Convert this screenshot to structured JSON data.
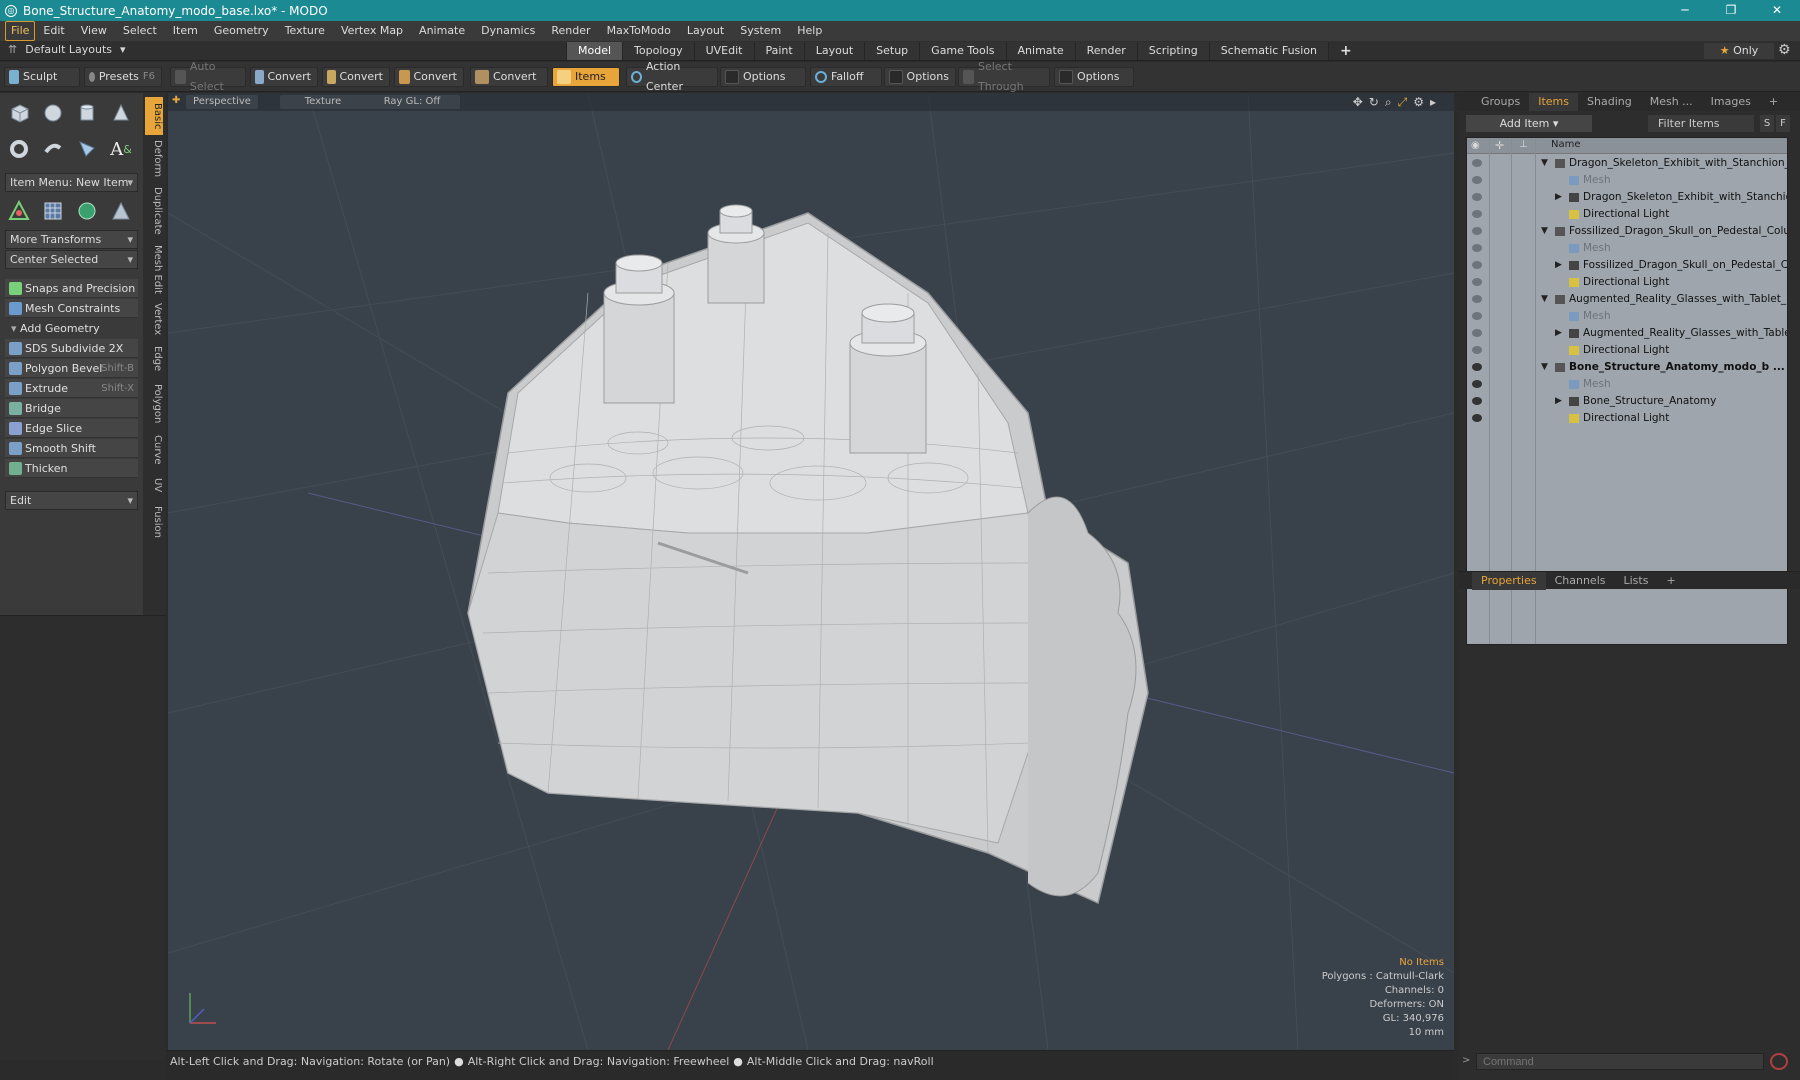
{
  "window": {
    "title": "Bone_Structure_Anatomy_modo_base.lxo* - MODO",
    "controls": [
      "─",
      "❐",
      "✕"
    ]
  },
  "menu": [
    "File",
    "Edit",
    "View",
    "Select",
    "Item",
    "Geometry",
    "Texture",
    "Vertex Map",
    "Animate",
    "Dynamics",
    "Render",
    "MaxToModo",
    "Layout",
    "System",
    "Help"
  ],
  "layoutbar": {
    "default_layouts": "Default Layouts",
    "tabs": [
      "Model",
      "Topology",
      "UVEdit",
      "Paint",
      "Layout",
      "Setup",
      "Game Tools",
      "Animate",
      "Render",
      "Scripting",
      "Schematic Fusion"
    ],
    "active_tab": "Model",
    "only": "Only"
  },
  "toolbar": {
    "sculpt": "Sculpt",
    "presets": "Presets",
    "presets_key": "F6",
    "auto_select": "Auto Select",
    "convert": "Convert",
    "items": "Items",
    "action_center": "Action Center",
    "options": "Options",
    "falloff": "Falloff",
    "select_through": "Select Through"
  },
  "left": {
    "item_menu": "Item Menu: New Item",
    "more_transforms": "More Transforms",
    "center_selected": "Center Selected",
    "snaps": "Snaps and Precision",
    "mesh_constraints": "Mesh Constraints",
    "add_geometry": "Add Geometry",
    "tools": [
      {
        "label": "SDS Subdivide 2X",
        "shortcut": ""
      },
      {
        "label": "Polygon Bevel",
        "shortcut": "Shift-B"
      },
      {
        "label": "Extrude",
        "shortcut": "Shift-X"
      },
      {
        "label": "Bridge",
        "shortcut": ""
      },
      {
        "label": "Edge Slice",
        "shortcut": ""
      },
      {
        "label": "Smooth Shift",
        "shortcut": ""
      },
      {
        "label": "Thicken",
        "shortcut": ""
      }
    ],
    "edit": "Edit",
    "vtabs": [
      "Basic",
      "Deform",
      "Duplicate",
      "Mesh Edit",
      "Vertex",
      "Edge",
      "Polygon",
      "Curve",
      "UV",
      "Fusion"
    ]
  },
  "viewport": {
    "perspective": "Perspective",
    "texture": "Texture",
    "raygl": "Ray GL: Off",
    "stats": {
      "no_items": "No Items",
      "polygons": "Polygons : Catmull-Clark",
      "channels": "Channels: 0",
      "deformers": "Deformers: ON",
      "gl": "GL: 340,976",
      "scale": "10 mm"
    }
  },
  "status": {
    "hint1": "Alt-Left Click and Drag: Navigation: Rotate (or Pan)",
    "hint2": "Alt-Right Click and Drag: Navigation: Freewheel",
    "hint3": "Alt-Middle Click and Drag: navRoll"
  },
  "right": {
    "tabs": [
      "Groups",
      "Items",
      "Shading",
      "Mesh ...",
      "Images"
    ],
    "active_tab": "Items",
    "add_item": "Add Item",
    "filter_items": "Filter Items",
    "s_btn": "S",
    "f_btn": "F",
    "name_col": "Name",
    "rows": [
      {
        "label": "Dragon_Skeleton_Exhibit_with_Stanchion_...",
        "kind": "scene",
        "indent": 0,
        "expanded": true
      },
      {
        "label": "Mesh",
        "kind": "mesh",
        "indent": 1
      },
      {
        "label": "Dragon_Skeleton_Exhibit_with_Stanchio ...",
        "kind": "group",
        "indent": 1,
        "collapsed": true
      },
      {
        "label": "Directional Light",
        "kind": "light",
        "indent": 1
      },
      {
        "label": "Fossilized_Dragon_Skull_on_Pedestal_Colu ...",
        "kind": "scene",
        "indent": 0,
        "expanded": true
      },
      {
        "label": "Mesh",
        "kind": "mesh",
        "indent": 1
      },
      {
        "label": "Fossilized_Dragon_Skull_on_Pedestal_C ...",
        "kind": "group",
        "indent": 1,
        "collapsed": true
      },
      {
        "label": "Directional Light",
        "kind": "light",
        "indent": 1
      },
      {
        "label": "Augmented_Reality_Glasses_with_Tablet_ ...",
        "kind": "scene",
        "indent": 0,
        "expanded": true
      },
      {
        "label": "Mesh",
        "kind": "mesh",
        "indent": 1
      },
      {
        "label": "Augmented_Reality_Glasses_with_Table ...",
        "kind": "group",
        "indent": 1,
        "collapsed": true
      },
      {
        "label": "Directional Light",
        "kind": "light",
        "indent": 1
      },
      {
        "label": "Bone_Structure_Anatomy_modo_b ...",
        "kind": "scene",
        "indent": 0,
        "expanded": true,
        "bold": true
      },
      {
        "label": "Mesh",
        "kind": "mesh",
        "indent": 1
      },
      {
        "label": "Bone_Structure_Anatomy",
        "kind": "group",
        "indent": 1,
        "collapsed": true
      },
      {
        "label": "Directional Light",
        "kind": "light",
        "indent": 1
      }
    ],
    "lower_tabs": [
      "Properties",
      "Channels",
      "Lists"
    ],
    "lower_active": "Properties",
    "command_placeholder": "Command"
  }
}
